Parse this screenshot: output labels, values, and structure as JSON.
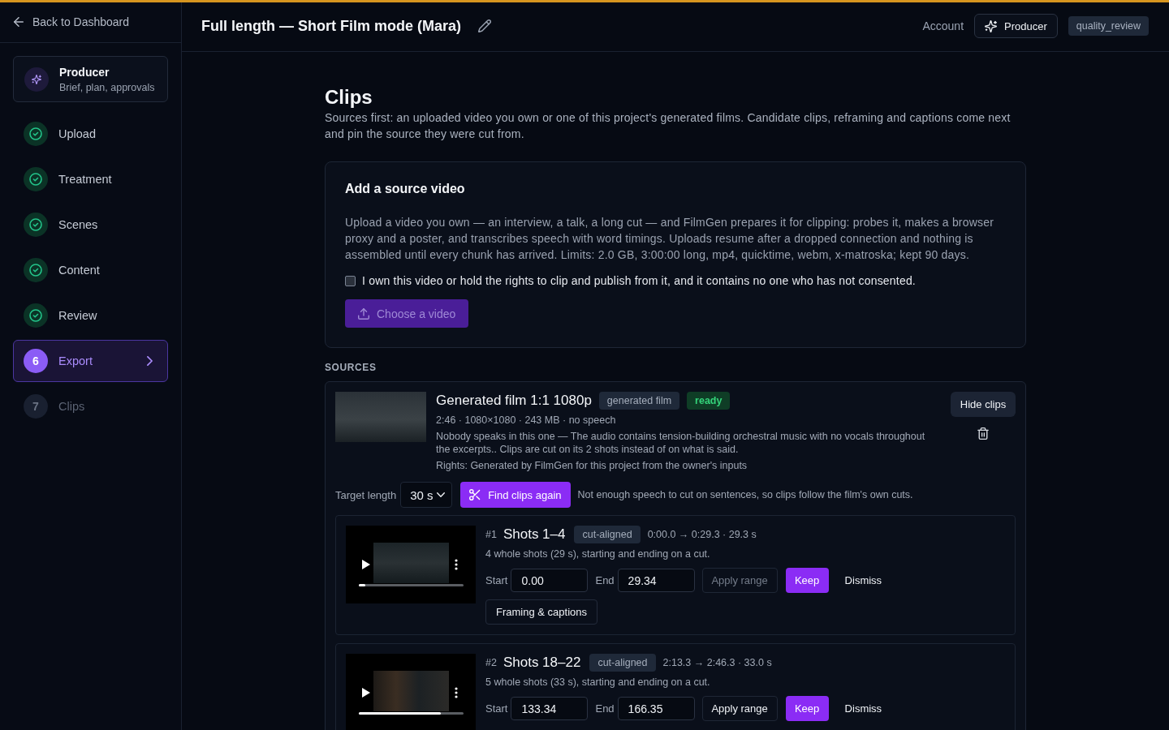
{
  "sidebar": {
    "back_link": "Back to Dashboard",
    "producer": {
      "title": "Producer",
      "subtitle": "Brief, plan, approvals"
    },
    "steps": [
      {
        "label": "Upload",
        "kind": "done",
        "selected": false,
        "disabled": false
      },
      {
        "label": "Treatment",
        "kind": "done",
        "selected": false,
        "disabled": false
      },
      {
        "label": "Scenes",
        "kind": "done",
        "selected": false,
        "disabled": false
      },
      {
        "label": "Content",
        "kind": "done",
        "selected": false,
        "disabled": false
      },
      {
        "label": "Review",
        "kind": "done",
        "selected": false,
        "disabled": false
      },
      {
        "label": "Export",
        "number": "6",
        "kind": "numbered",
        "selected": true,
        "disabled": false
      },
      {
        "label": "Clips",
        "number": "7",
        "kind": "numbered",
        "selected": false,
        "disabled": true
      }
    ]
  },
  "header": {
    "title": "Full length — Short Film mode (Mara)",
    "account_link": "Account",
    "role_button": "Producer",
    "role_badge": "quality_review"
  },
  "page": {
    "title": "Clips",
    "description": "Sources first: an uploaded video you own or one of this project's generated films. Candidate clips, reframing and captions come next and pin the source they were cut from."
  },
  "add_source": {
    "title": "Add a source video",
    "text": "Upload a video you own — an interview, a talk, a long cut — and FilmGen prepares it for clipping: probes it, makes a browser proxy and a poster, and transcribes speech with word timings. Uploads resume after a dropped connection and nothing is assembled until every chunk has arrived. Limits: 2.0 GB, 3:00:00 long, mp4, quicktime, webm, x-matroska; kept 90 days.",
    "consent": {
      "label": "I own this video or hold the rights to clip and publish from it, and it contains no one who has not consented.",
      "checked": false
    },
    "choose_button": {
      "label": "Choose a video",
      "disabled": true
    }
  },
  "sources_label": "SOURCES",
  "sources": [
    {
      "title": "Generated film 1:1 1080p",
      "badges": [
        {
          "label": "generated film",
          "kind": "neutral"
        },
        {
          "label": "ready",
          "kind": "success"
        }
      ],
      "meta": "2:46 · 1080×1080 · 243 MB · no speech",
      "description": "Nobody speaks in this one — The audio contains tension-building orchestral music with no vocals throughout the excerpts.. Clips are cut on its 2 shots instead of on what is said.",
      "rights": "Rights: Generated by FilmGen for this project from the owner's inputs",
      "hide_button": "Hide clips",
      "target_label": "Target length",
      "target_value": "30 s",
      "find_button": "Find clips again",
      "note": "Not enough speech to cut on sentences, so clips follow the film's own cuts.",
      "clips": [
        {
          "number": "#1",
          "title": "Shots 1–4",
          "badge": "cut-aligned",
          "timing": "0:00.0 → 0:29.3 · 29.3 s",
          "summary": "4 whole shots (29 s), starting and ending on a cut.",
          "player": {
            "level": 0.06
          },
          "start_label": "Start",
          "start": "0.00",
          "end_label": "End",
          "end": "29.34",
          "apply": {
            "label": "Apply range",
            "disabled": true
          },
          "keep_button": "Keep",
          "dismiss_button": "Dismiss",
          "framing_button": "Framing & captions"
        },
        {
          "number": "#2",
          "title": "Shots 18–22",
          "badge": "cut-aligned",
          "timing": "2:13.3 → 2:46.3 · 33.0 s",
          "summary": "5 whole shots (33 s), starting and ending on a cut.",
          "player": {
            "level": 0.78
          },
          "start_label": "Start",
          "start": "133.34",
          "end_label": "End",
          "end": "166.35",
          "apply": {
            "label": "Apply range",
            "disabled": false
          },
          "keep_button": "Keep",
          "dismiss_button": "Dismiss"
        }
      ]
    }
  ]
}
